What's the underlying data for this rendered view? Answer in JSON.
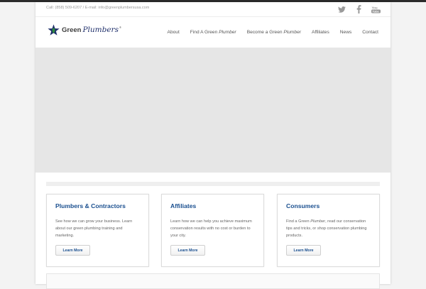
{
  "topbar": {
    "contact_text": "Call: (858) 509-6207 / E-mail: info@greenplumbersusa.com",
    "social": [
      {
        "icon": "twitter-icon"
      },
      {
        "icon": "facebook-icon"
      },
      {
        "icon": "youtube-icon"
      }
    ]
  },
  "logo": {
    "word_green": "Green",
    "word_plumbers": "Plumbers",
    "reg": "®",
    "star_color": "#1f2f6b",
    "leaf_color": "#2e8b3e"
  },
  "nav": {
    "about": "About",
    "find_prefix": "Find A Green",
    "find_em": "Plumber",
    "become_prefix": "Become a Green",
    "become_em": "Plumber",
    "affiliates": "Affiliates",
    "news": "News",
    "contact": "Contact"
  },
  "cards": [
    {
      "title": "Plumbers & Contractors",
      "body": "See how we can grow your business. Learn about our green plumbing training and marketing.",
      "button": "Learn More"
    },
    {
      "title": "Affiliates",
      "body": "Learn how we can help you achieve maximum conservation results with no cost or burden to your city.",
      "button": "Learn More"
    },
    {
      "title": "Consumers",
      "body_prefix": "Find a Green",
      "body_em": "Plumber",
      "body_suffix": ", read our conservation tips and tricks, or shop conservation plumbing products.",
      "button": "Learn More"
    }
  ],
  "colors": {
    "accent_blue": "#1a4f8f",
    "hero_gray": "#e6e6e6"
  }
}
